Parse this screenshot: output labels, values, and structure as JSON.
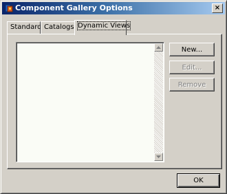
{
  "window": {
    "title": "Component Gallery Options",
    "close_symbol": "×",
    "icons": {
      "app": "gallery-app-icon",
      "close": "close-icon",
      "scroll_up": "scroll-up-arrow-icon",
      "scroll_down": "scroll-down-arrow-icon"
    }
  },
  "tabs": [
    {
      "label": "Standard",
      "active": false
    },
    {
      "label": "Catalogs",
      "active": false
    },
    {
      "label": "Dynamic Views",
      "active": true
    }
  ],
  "dynamic_views": {
    "items": []
  },
  "buttons": {
    "new": {
      "label": "New...",
      "enabled": true
    },
    "edit": {
      "label": "Edit...",
      "enabled": false
    },
    "remove": {
      "label": "Remove",
      "enabled": false
    },
    "ok": {
      "label": "OK",
      "enabled": true
    }
  },
  "colors": {
    "title_gradient_start": "#0a246a",
    "title_gradient_end": "#a6caf0",
    "face": "#d4d0c8",
    "list_background": "#fafcf6"
  }
}
